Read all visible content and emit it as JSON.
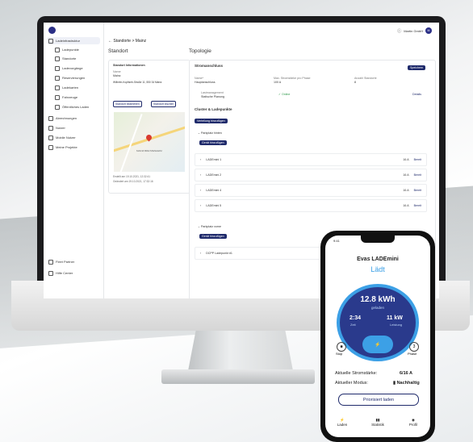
{
  "sidebar": {
    "items": [
      {
        "label": "Ladeinfrastruktur",
        "active": true
      },
      {
        "label": "Ladepunkte"
      },
      {
        "label": "Standorte"
      },
      {
        "label": "Ladevorgänge"
      },
      {
        "label": "Reservierungen"
      },
      {
        "label": "Ladekarten"
      },
      {
        "label": "Fahrzeuge"
      },
      {
        "label": "Öffentliches Laden"
      },
      {
        "label": "Abrechnungen"
      },
      {
        "label": "Nutzer"
      },
      {
        "label": "Mobile Nutzer"
      },
      {
        "label": "Meine Projekte"
      }
    ],
    "footer": [
      {
        "label": "Fleet Partner"
      },
      {
        "label": "Hilfe Center"
      }
    ]
  },
  "topbar": {
    "user_name": "Martin GmbH",
    "avatar_initials": "M"
  },
  "breadcrumb": "← Standorte  >  Mainz",
  "left": {
    "heading": "Standort",
    "info_title": "Standort Informationen",
    "name_label": "Name",
    "name": "Mainz",
    "address": "Wilhelm-Kopfsieb-Straße 11, 550 34 Mainz",
    "btn_edit": "Standort bearbeiten",
    "btn_delete": "Standort löschen",
    "map_label": "MAINZ BRETZENHEIM",
    "created": "Erstellt am 19.10.2021, 12:32:41",
    "updated": "Geändert am 19.10.2021, 17:32:16"
  },
  "right": {
    "heading": "Topologie",
    "section1_title": "Stromanschluss",
    "section1_btn": "Speichern",
    "field1_label": "Name*",
    "field1_value": "Hauptanschluss",
    "field2_label": "Max. Stromstärke pro Phase",
    "field2_value": "100 A",
    "field3_label": "Anzahl Standorte",
    "field3_value": "8",
    "ladeplanung_label": "Lastmanagement",
    "ladeplanung_value": "Statische Planung",
    "status_online": "Online",
    "details_link": "Details",
    "section2_title": "Cluster & Ladepunkte",
    "section2_btn": "Verteilung hinzufügen",
    "cluster1": "Parkplatz hinten",
    "cluster1_btn": "Gerät hinzufügen",
    "chargers": [
      {
        "name": "LADEmini 1",
        "current": "16 A",
        "status": "Bereit"
      },
      {
        "name": "LADEmini 2",
        "current": "16 A",
        "status": "Bereit"
      },
      {
        "name": "LADEmini 4",
        "current": "16 A",
        "status": "Bereit"
      },
      {
        "name": "LADEmini 5",
        "current": "16 A",
        "status": "Bereit"
      }
    ],
    "cluster2": "Parkplatz vorne",
    "cluster2_btn": "Gerät hinzufügen",
    "charger_last": "DCPP Ladepunkt #1"
  },
  "phone": {
    "title": "Evas LADEmini",
    "state": "Lädt",
    "energy": "12.8 kWh",
    "energy_label": "geladen",
    "time": "2:34",
    "time_label": "Zeit",
    "power": "11 kW",
    "power_label": "Leistung",
    "stop_label": "Stop",
    "phase_label": "Phase",
    "phase_value": "3",
    "current_label": "Aktuelle Stromstärke:",
    "current_value": "6/16 A",
    "mode_label": "Aktueller Modus:",
    "mode_value": "Nachhaltig",
    "prio_button": "Priorisiert laden",
    "tabs": [
      "Laden",
      "Statistik",
      "Profil"
    ],
    "status_time": "9:41"
  }
}
